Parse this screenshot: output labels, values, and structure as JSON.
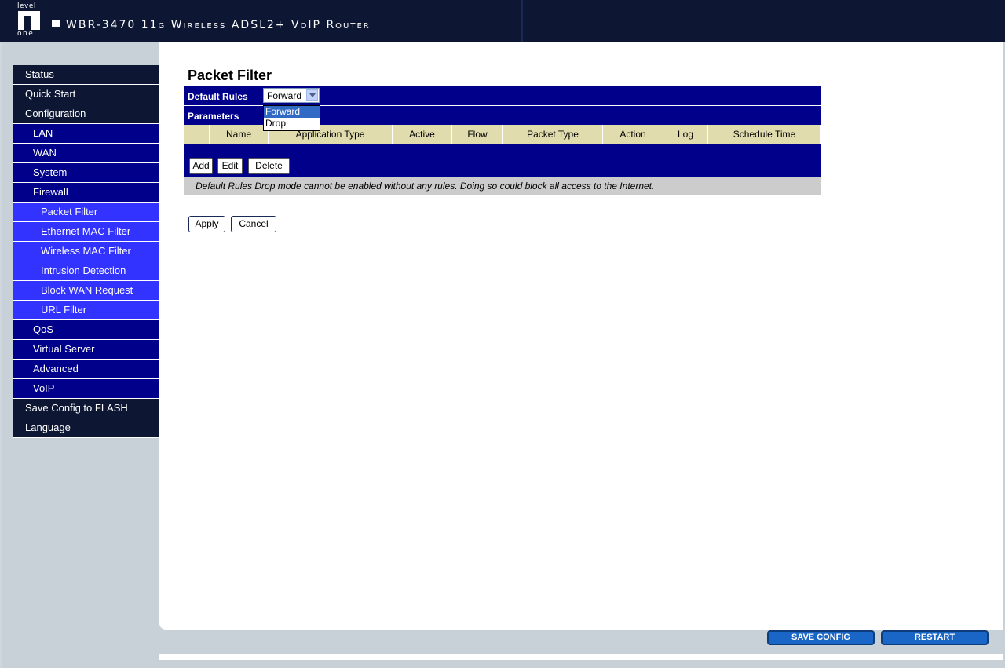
{
  "header": {
    "logo_top": "level",
    "logo_bottom": "one",
    "title": "WBR-3470 11g Wireless ADSL2+ VoIP Router"
  },
  "menu": [
    {
      "label": "Status",
      "level": 1
    },
    {
      "label": "Quick Start",
      "level": 1
    },
    {
      "label": "Configuration",
      "level": 1
    },
    {
      "label": "LAN",
      "level": 2
    },
    {
      "label": "WAN",
      "level": 2
    },
    {
      "label": "System",
      "level": 2
    },
    {
      "label": "Firewall",
      "level": 2
    },
    {
      "label": "Packet Filter",
      "level": 3
    },
    {
      "label": "Ethernet MAC Filter",
      "level": 3
    },
    {
      "label": "Wireless MAC Filter",
      "level": 3
    },
    {
      "label": "Intrusion Detection",
      "level": 3
    },
    {
      "label": "Block WAN Request",
      "level": 3
    },
    {
      "label": "URL Filter",
      "level": 3
    },
    {
      "label": "QoS",
      "level": 2
    },
    {
      "label": "Virtual Server",
      "level": 2
    },
    {
      "label": "Advanced",
      "level": 2
    },
    {
      "label": "VoIP",
      "level": 2
    },
    {
      "label": "Save Config to FLASH",
      "level": 1
    },
    {
      "label": "Language",
      "level": 1
    }
  ],
  "page": {
    "title": "Packet Filter",
    "default_rules_label": "Default Rules",
    "default_rules_value": "Forward",
    "default_rules_options": [
      "Forward",
      "Drop"
    ],
    "parameters_label": "Parameters",
    "columns": [
      "",
      "Name",
      "Application Type",
      "Active",
      "Flow",
      "Packet Type",
      "Action",
      "Log",
      "Schedule Time"
    ],
    "add_label": "Add",
    "edit_label": "Edit",
    "delete_label": "Delete",
    "note": "Default Rules Drop mode cannot be enabled without any rules. Doing so could block all access to the Internet.",
    "apply_label": "Apply",
    "cancel_label": "Cancel"
  },
  "footer": {
    "save_config_label": "SAVE CONFIG",
    "restart_label": "RESTART"
  }
}
